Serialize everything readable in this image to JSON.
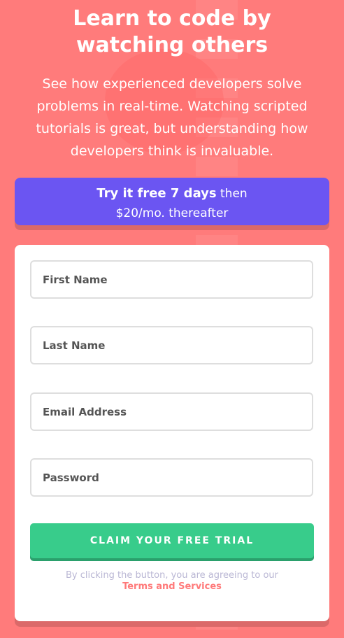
{
  "hero": {
    "title_line1": "Learn to code by",
    "title_line2": "watching others",
    "description_line1": "See how experienced developers solve",
    "description_line2": "problems in real-time. Watching scripted",
    "description_line3": "tutorials is great, but understanding how",
    "description_line4": "developers think is invaluable."
  },
  "offer": {
    "strong_text": "Try it free 7 days",
    "after_strong": "then",
    "price_text": "$20/mo. thereafter"
  },
  "form": {
    "first_name_placeholder": "First Name",
    "last_name_placeholder": "Last Name",
    "email_placeholder": "Email Address",
    "password_placeholder": "Password",
    "submit_label": "CLAIM YOUR FREE TRIAL",
    "legal_text": "By clicking the button, you are agreeing to our",
    "terms_link": "Terms and Services"
  },
  "colors": {
    "background": "#ff7b7b",
    "offer_bg": "#6b55f2",
    "submit_bg": "#38cc8b",
    "terms_color": "#ff7a7a"
  }
}
